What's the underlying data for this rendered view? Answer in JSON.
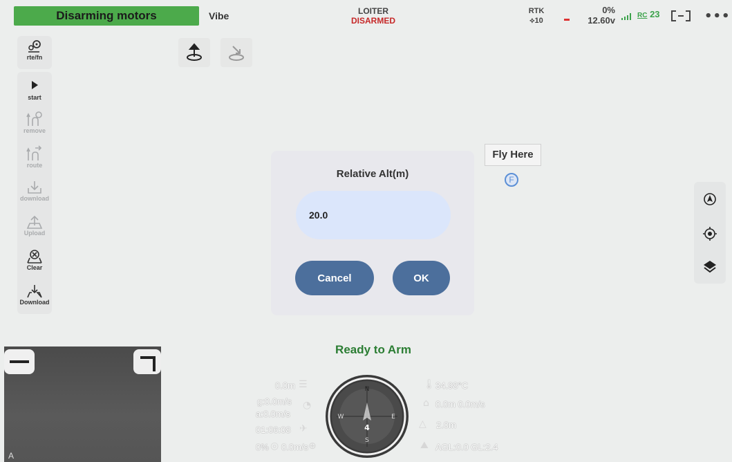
{
  "topbar": {
    "status_message": "Disarming motors",
    "vibe_label": "Vibe",
    "flight_mode": "LOITER",
    "arm_state": "DISARMED",
    "gps_type": "RTK",
    "satellites": "10",
    "battery_percent": "0%",
    "battery_voltage": "12.60v",
    "rc_label": "RC",
    "rc_value": "23",
    "more_label": "•••"
  },
  "left_toolbar": {
    "rte_fn": "rte/fn",
    "start": "start",
    "remove": "remove",
    "route": "route",
    "download_dim": "download",
    "upload": "Upload",
    "clear": "Clear",
    "download": "Download"
  },
  "map": {
    "fly_here_label": "Fly Here",
    "fly_marker_letter": "F"
  },
  "dialog": {
    "title": "Relative Alt(m)",
    "altitude_value": "20.0",
    "cancel_label": "Cancel",
    "ok_label": "OK"
  },
  "status": {
    "ready_text": "Ready to Arm"
  },
  "video": {
    "label": "A"
  },
  "telemetry": {
    "alt": "0.0m",
    "ground_speed": "g:0.0m/s",
    "air_speed": "a:0.0m/s",
    "flight_time": "01:06:08",
    "throttle": "0%",
    "vertical_speed": "0.0m/s",
    "temperature": "34.98°C",
    "dist_speed": "0.0m 0.0m/s",
    "home_dist": "2.0m",
    "agl": "AGL:0.0 GL:2.4",
    "compass_heading": "4"
  }
}
